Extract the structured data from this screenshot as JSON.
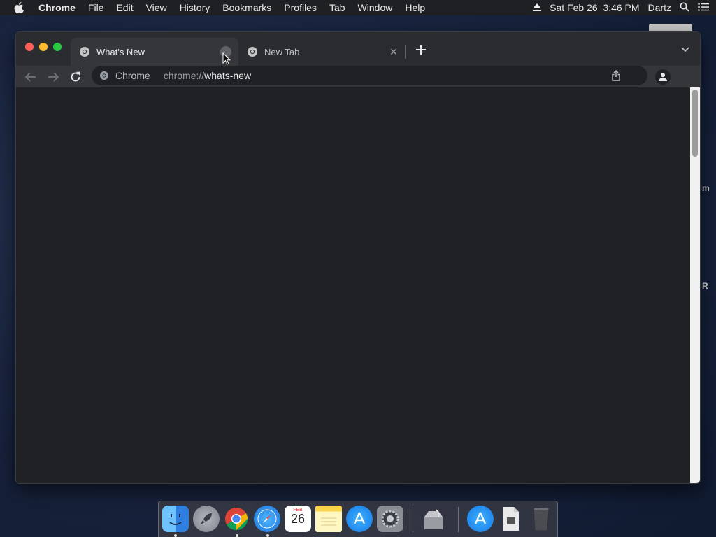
{
  "menubar": {
    "items": [
      "Chrome",
      "File",
      "Edit",
      "View",
      "History",
      "Bookmarks",
      "Profiles",
      "Tab",
      "Window",
      "Help"
    ],
    "clock": "Sat Feb 26  3:46 PM",
    "user": "Dartz",
    "icons": [
      "apple-icon",
      "eject-icon",
      "spotlight-icon",
      "notification-center-icon"
    ]
  },
  "desktop": {
    "labels": [
      "m",
      "R"
    ]
  },
  "browser": {
    "tabs": [
      {
        "title": "What's New",
        "active": true
      },
      {
        "title": "New Tab",
        "active": false
      }
    ],
    "omnibox": {
      "site_name": "Chrome",
      "url_prefix": "chrome://",
      "url_path": "whats-new"
    }
  },
  "dock": {
    "calendar_month": "FEB",
    "calendar_day": "26",
    "apps": [
      "Finder",
      "Launchpad",
      "Google Chrome",
      "Safari",
      "Calendar",
      "Notes",
      "App Store",
      "System Preferences",
      "Archive Utility",
      "Applications",
      "Documents",
      "Trash"
    ]
  },
  "colors": {
    "window_bg": "#202124",
    "tab_active": "#35363a",
    "menubar_bg": "#1f2024"
  }
}
